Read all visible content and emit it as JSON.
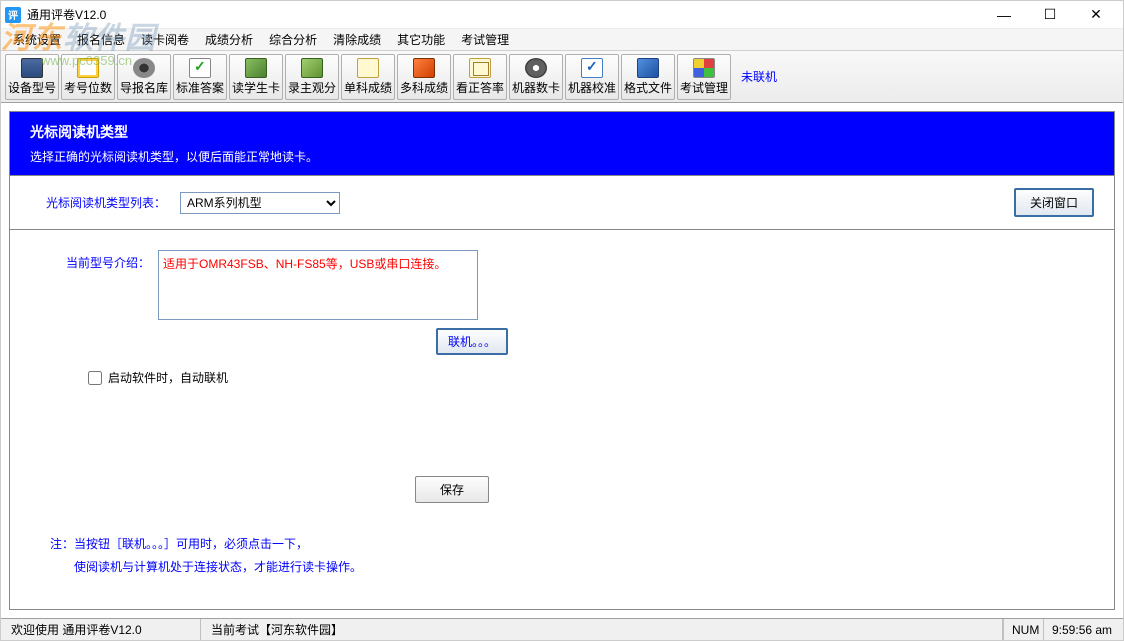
{
  "app": {
    "title": "通用评卷V12.0",
    "icon_letter": "评"
  },
  "menu": {
    "items": [
      "系统设置",
      "报名信息",
      "读卡阅卷",
      "成绩分析",
      "综合分析",
      "清除成绩",
      "其它功能",
      "考试管理"
    ]
  },
  "watermark": {
    "brand_prefix": "河东",
    "brand_suffix": "软件园",
    "url": "www.pc0359.cn"
  },
  "toolbar": {
    "buttons": [
      {
        "label": "设备型号",
        "icon": "ic1"
      },
      {
        "label": "考号位数",
        "icon": "ic2"
      },
      {
        "label": "导报名库",
        "icon": "ic3"
      },
      {
        "label": "标准答案",
        "icon": "ic4"
      },
      {
        "label": "读学生卡",
        "icon": "ic5"
      },
      {
        "label": "录主观分",
        "icon": "ic6"
      },
      {
        "label": "单科成绩",
        "icon": "ic7"
      },
      {
        "label": "多科成绩",
        "icon": "ic8"
      },
      {
        "label": "看正答率",
        "icon": "ic9"
      },
      {
        "label": "机器数卡",
        "icon": "ic10"
      },
      {
        "label": "机器校准",
        "icon": "ic11"
      },
      {
        "label": "格式文件",
        "icon": "ic12"
      },
      {
        "label": "考试管理",
        "icon": "ic13"
      }
    ],
    "status": "未联机"
  },
  "header": {
    "title": "光标阅读机类型",
    "desc": "选择正确的光标阅读机类型，以便后面能正常地读卡。"
  },
  "select_row": {
    "label": "光标阅读机类型列表：",
    "value": "ARM系列机型",
    "close_btn": "关闭窗口"
  },
  "intro": {
    "label": "当前型号介绍：",
    "text": "适用于OMR43FSB、NH-FS85等，USB或串口连接。"
  },
  "connect_btn": "联机。。。",
  "checkbox_label": "启动软件时，自动联机",
  "save_btn": "保存",
  "note_line1": "注：当按钮［联机。。。］可用时，必须点击一下，",
  "note_line2": "使阅读机与计算机处于连接状态，才能进行读卡操作。",
  "statusbar": {
    "welcome": "欢迎使用  通用评卷V12.0",
    "exam": "当前考试【河东软件园】",
    "num": "NUM",
    "time": "9:59:56 am"
  }
}
